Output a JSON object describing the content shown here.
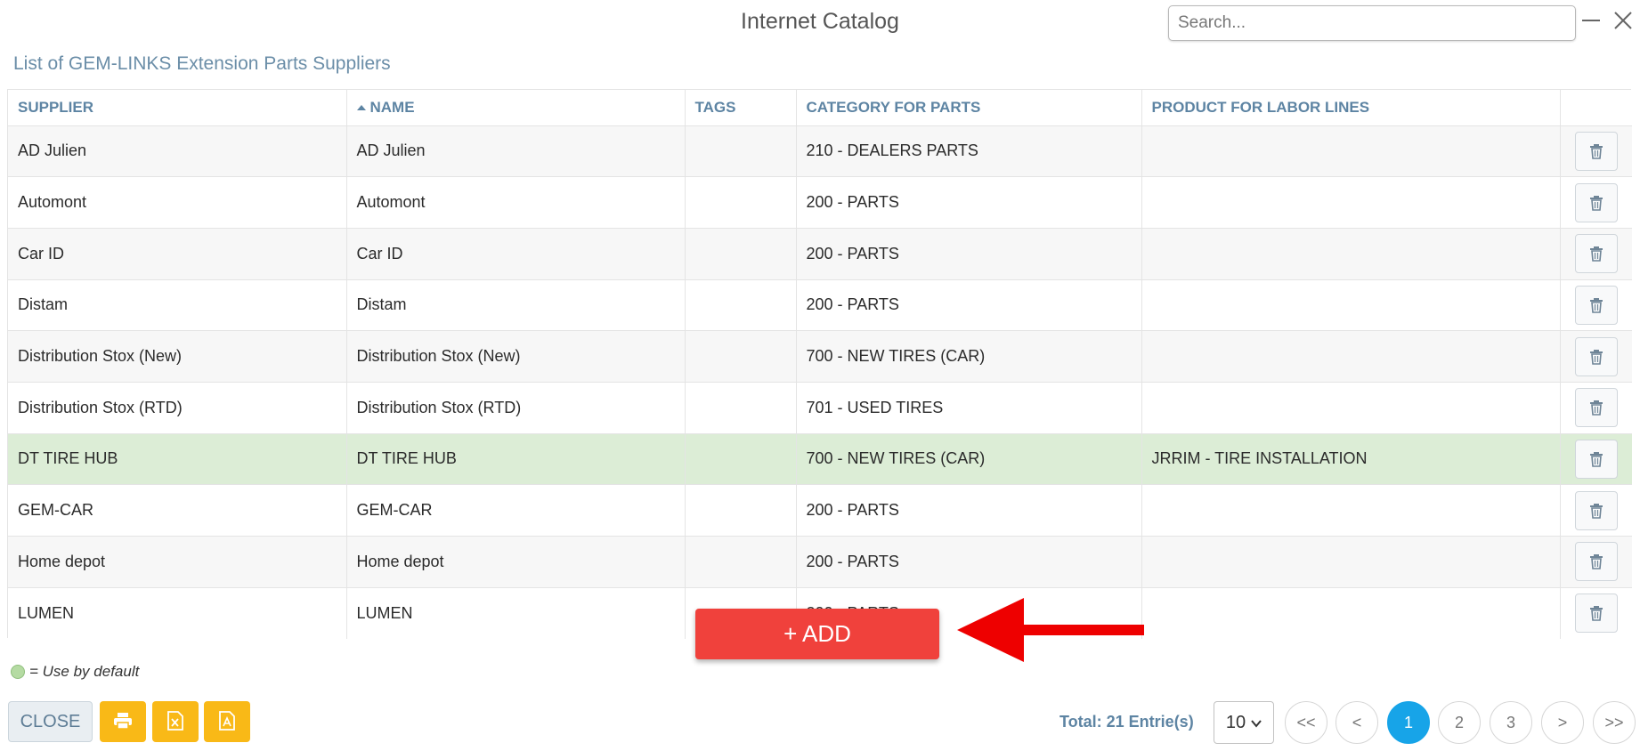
{
  "window": {
    "title": "Internet Catalog",
    "search_placeholder": "Search..."
  },
  "subtitle": "List of GEM-LINKS Extension Parts Suppliers",
  "table": {
    "columns": {
      "supplier": "SUPPLIER",
      "name": "NAME",
      "tags": "TAGS",
      "category": "CATEGORY FOR PARTS",
      "product": "PRODUCT FOR LABOR LINES"
    },
    "sorted_column": "name",
    "sort_direction": "ascending",
    "rows": [
      {
        "supplier": "AD Julien",
        "name": "AD Julien",
        "tags": "",
        "category": "210 - DEALERS PARTS",
        "product": "",
        "default": false
      },
      {
        "supplier": "Automont",
        "name": "Automont",
        "tags": "",
        "category": "200 - PARTS",
        "product": "",
        "default": false
      },
      {
        "supplier": "Car ID",
        "name": "Car ID",
        "tags": "",
        "category": "200 - PARTS",
        "product": "",
        "default": false
      },
      {
        "supplier": "Distam",
        "name": "Distam",
        "tags": "",
        "category": "200 - PARTS",
        "product": "",
        "default": false
      },
      {
        "supplier": "Distribution Stox (New)",
        "name": "Distribution Stox (New)",
        "tags": "",
        "category": "700 - NEW TIRES (CAR)",
        "product": "",
        "default": false
      },
      {
        "supplier": "Distribution Stox (RTD)",
        "name": "Distribution Stox (RTD)",
        "tags": "",
        "category": "701 - USED TIRES",
        "product": "",
        "default": false
      },
      {
        "supplier": "DT TIRE HUB",
        "name": "DT TIRE HUB",
        "tags": "",
        "category": "700 - NEW TIRES (CAR)",
        "product": "JRRIM - TIRE INSTALLATION",
        "default": true
      },
      {
        "supplier": "GEM-CAR",
        "name": "GEM-CAR",
        "tags": "",
        "category": "200 - PARTS",
        "product": "",
        "default": false
      },
      {
        "supplier": "Home depot",
        "name": "Home depot",
        "tags": "",
        "category": "200 - PARTS",
        "product": "",
        "default": false
      },
      {
        "supplier": "LUMEN",
        "name": "LUMEN",
        "tags": "",
        "category": "200 - PARTS",
        "product": "",
        "default": false
      }
    ]
  },
  "add_button": "+ ADD",
  "legend": "= Use by default",
  "footer": {
    "close_label": "CLOSE",
    "actions": [
      "print-icon",
      "excel-icon",
      "pdf-icon"
    ],
    "total": "Total: 21 Entrie(s)",
    "page_size": "10",
    "pagination": [
      "<<",
      "<",
      "1",
      "2",
      "3",
      ">",
      ">>"
    ],
    "current_page": "1"
  },
  "colors": {
    "accent_blue": "#17a4e8",
    "header_text": "#5d84a3",
    "add_button": "#f0413c",
    "default_row": "#dcedd6",
    "action_yellow": "#f9b917",
    "annotation_arrow": "#ee0000"
  }
}
